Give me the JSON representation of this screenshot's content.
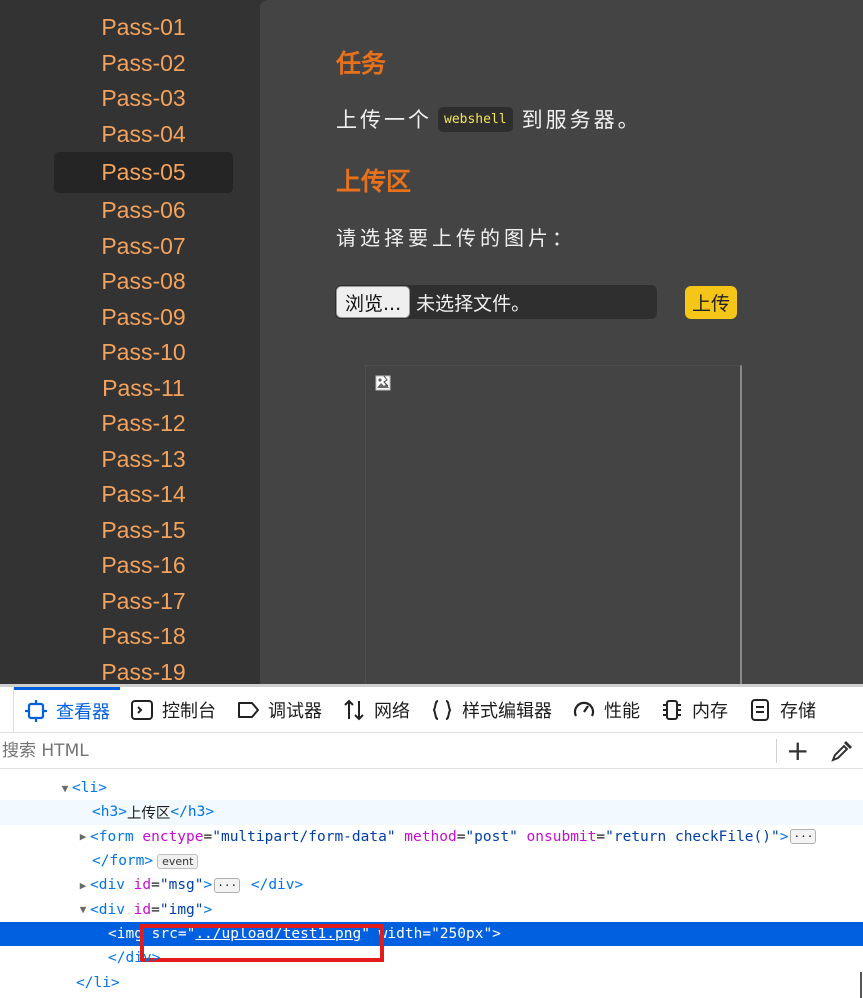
{
  "sidebar": {
    "items": [
      "Pass-01",
      "Pass-02",
      "Pass-03",
      "Pass-04",
      "Pass-05",
      "Pass-06",
      "Pass-07",
      "Pass-08",
      "Pass-09",
      "Pass-10",
      "Pass-11",
      "Pass-12",
      "Pass-13",
      "Pass-14",
      "Pass-15",
      "Pass-16",
      "Pass-17",
      "Pass-18",
      "Pass-19"
    ],
    "active_index": 4
  },
  "main": {
    "task_heading": "任务",
    "task_before": "上传一个",
    "task_code": "webshell",
    "task_after": "到服务器。",
    "upload_heading": "上传区",
    "choose_prompt": "请选择要上传的图片：",
    "browse_label": "浏览...",
    "file_status": "未选择文件。",
    "upload_label": "上传",
    "broken_image_icon": "broken-image-icon"
  },
  "devtools": {
    "tabs": [
      {
        "label": "查看器",
        "icon": "inspector-icon"
      },
      {
        "label": "控制台",
        "icon": "console-icon"
      },
      {
        "label": "调试器",
        "icon": "debugger-icon"
      },
      {
        "label": "网络",
        "icon": "network-icon"
      },
      {
        "label": "样式编辑器",
        "icon": "style-editor-icon"
      },
      {
        "label": "性能",
        "icon": "performance-icon"
      },
      {
        "label": "内存",
        "icon": "memory-icon"
      },
      {
        "label": "存储",
        "icon": "storage-icon"
      }
    ],
    "active_tab": 0,
    "search_placeholder": "搜索 HTML",
    "add_node_icon": "plus-icon",
    "picker_icon": "eyedropper-icon",
    "markup": {
      "li_open": "<li>",
      "h3_open": "<h3>",
      "h3_text": "上传区",
      "h3_close": "</h3>",
      "form_open": "<form",
      "form_attr1": "enctype",
      "form_val1": "\"multipart/form-data\"",
      "form_attr2": "method",
      "form_val2": "\"post\"",
      "form_attr3": "onsubmit",
      "form_val3": "\"return checkFile()\"",
      "form_close": "</form>",
      "event_badge": "event",
      "div_open": "<div",
      "msg_attr": "id",
      "msg_val": "\"msg\"",
      "div_close": "</div>",
      "img_div_attr": "id",
      "img_div_val": "\"img\"",
      "img_open": "<img",
      "src_attr": "src",
      "src_val": "../upload/test1.png",
      "width_attr": "width",
      "width_val": "\"250px\"",
      "li_close": "</li>",
      "ellipsis": "···"
    }
  }
}
